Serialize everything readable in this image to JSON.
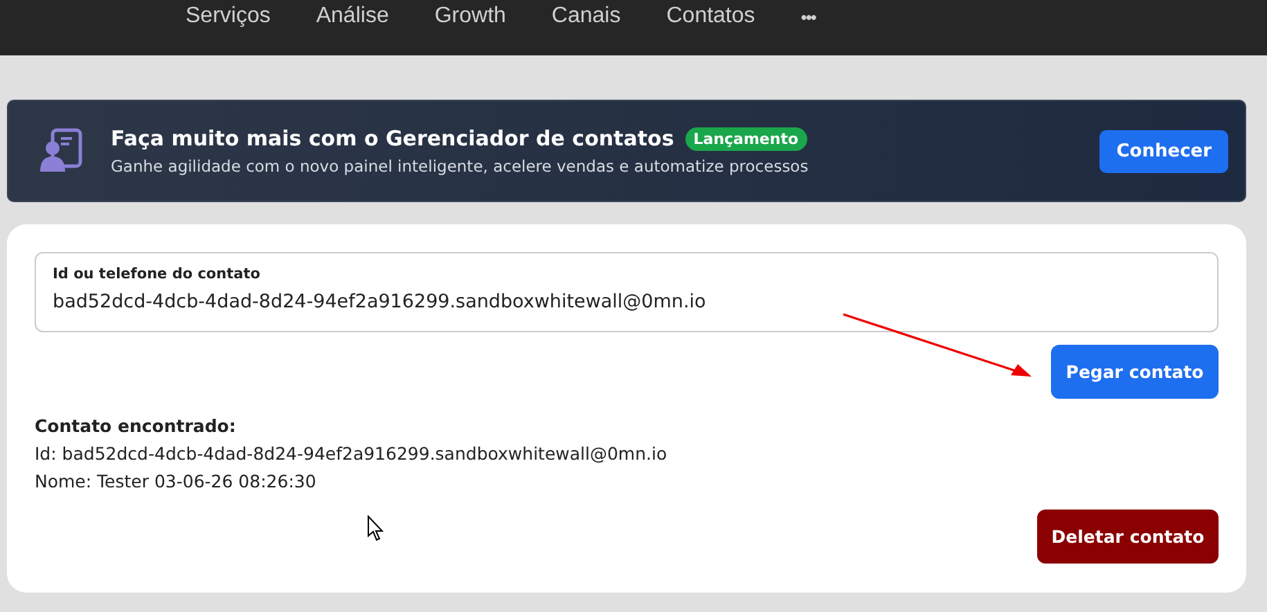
{
  "nav": {
    "items": [
      "Serviços",
      "Análise",
      "Growth",
      "Canais",
      "Contatos"
    ],
    "more": "•••"
  },
  "banner": {
    "title": "Faça muito mais com o Gerenciador de contatos",
    "badge": "Lançamento",
    "subtitle": "Ganhe agilidade com o novo painel inteligente, acelere vendas e automatize processos",
    "button": "Conhecer"
  },
  "form": {
    "field_label": "Id ou telefone do contato",
    "field_value": "bad52dcd-4dcb-4dad-8d24-94ef2a916299.sandboxwhitewall@0mn.io",
    "fetch_button": "Pegar contato"
  },
  "result": {
    "heading": "Contato encontrado:",
    "lines": [
      "Id: bad52dcd-4dcb-4dad-8d24-94ef2a916299.sandboxwhitewall@0mn.io",
      "Nome: Tester 03-06-26 08:26:30"
    ],
    "delete_button": "Deletar contato"
  }
}
